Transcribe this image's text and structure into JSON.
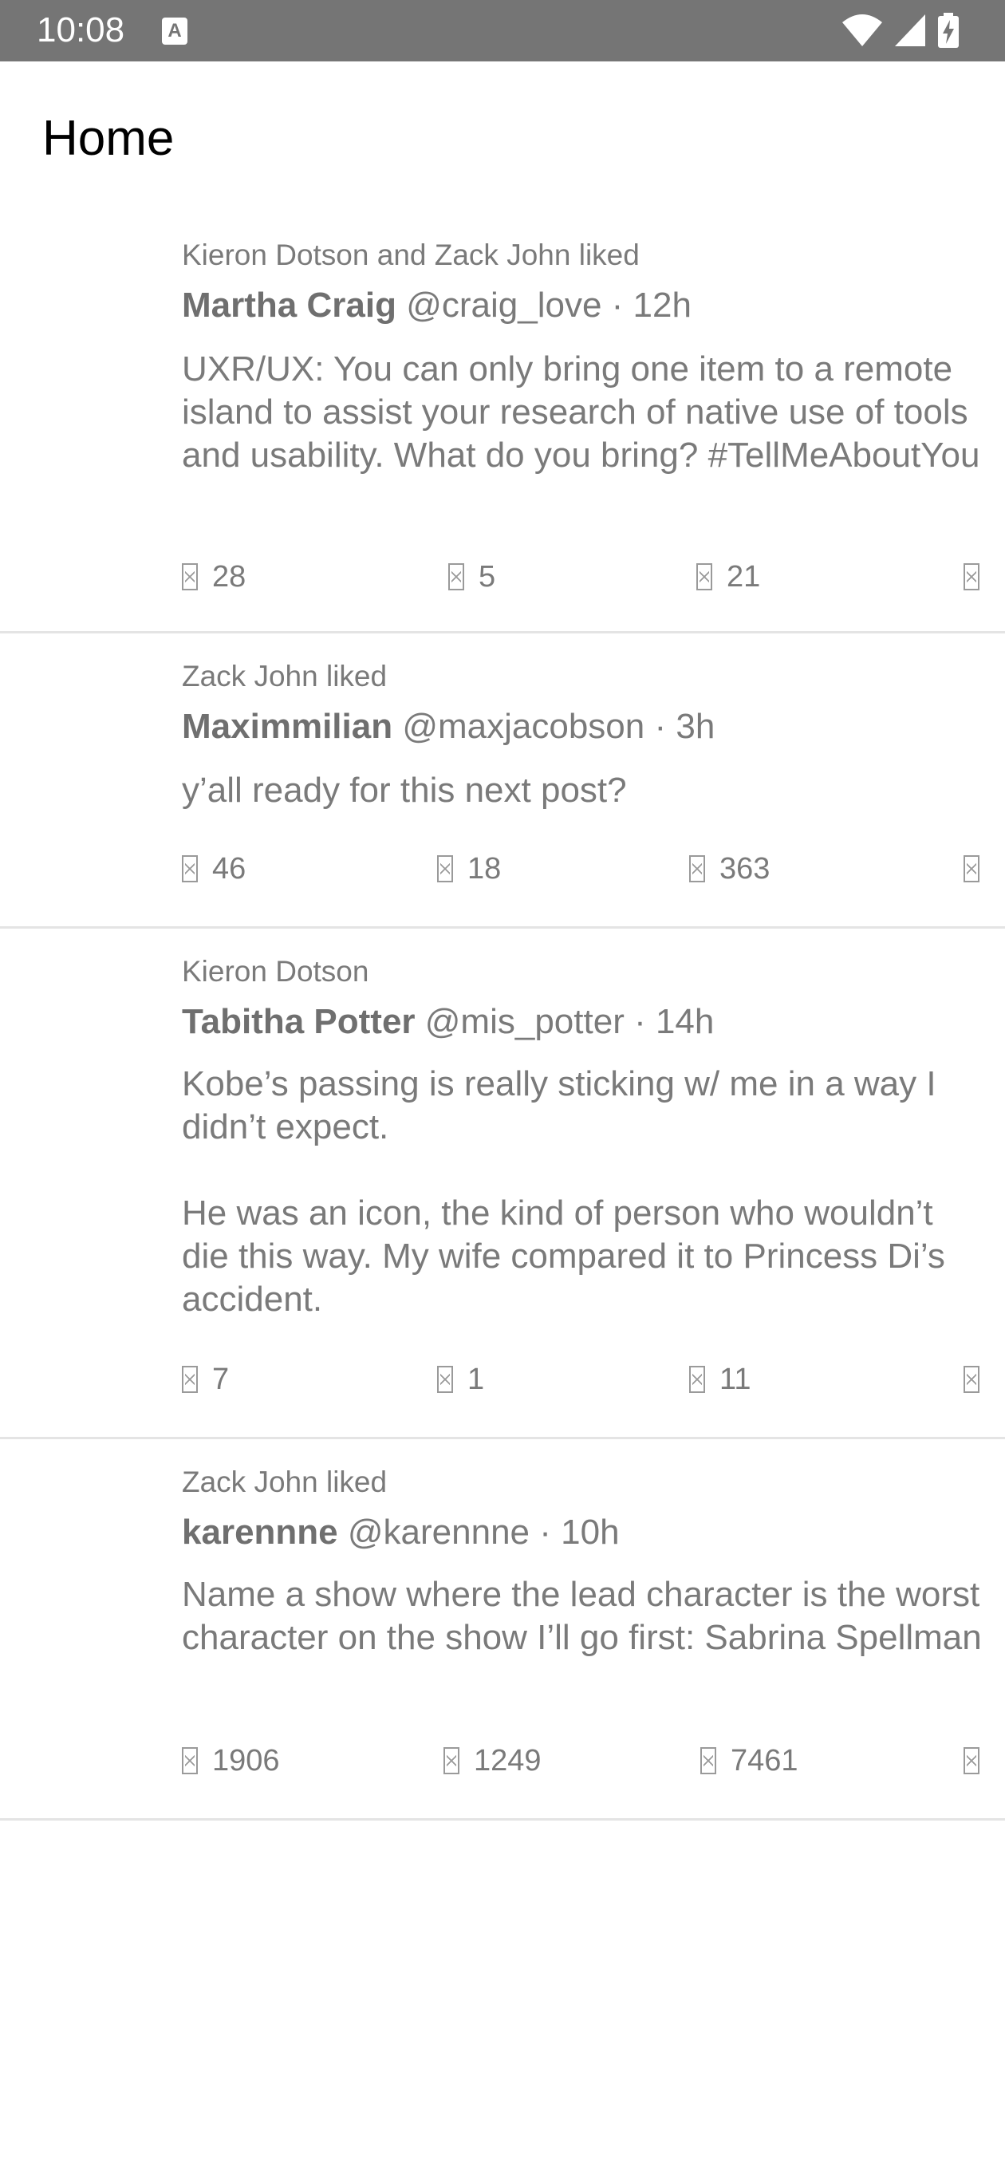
{
  "status_bar": {
    "time": "10:08",
    "notification_icon": "a-box-icon",
    "wifi_icon": "wifi-icon",
    "signal_icon": "signal-icon",
    "battery_icon": "battery-charging-icon"
  },
  "app_bar": {
    "title": "Home"
  },
  "tweets": [
    {
      "context": "Kieron Dotson and Zack John liked",
      "author": "Martha Craig",
      "handle": "@craig_love",
      "time": "· 12h",
      "body": "UXR/UX: You can only bring one item to a remote island to assist your research of native use of tools and usability. What do you bring? #TellMeAboutYou",
      "replies": "28",
      "retweets": "5",
      "likes": "21"
    },
    {
      "context": "Zack John liked",
      "author": "Maximmilian",
      "handle": "@maxjacobson",
      "time": "· 3h",
      "body": "y’all ready for this next post?",
      "replies": "46",
      "retweets": "18",
      "likes": "363"
    },
    {
      "context": "Kieron Dotson",
      "author": "Tabitha Potter",
      "handle": "@mis_potter",
      "time": "· 14h",
      "body": "Kobe’s passing is really sticking w/ me in a way I didn’t expect.\n\nHe was an icon, the kind of person who wouldn’t die this way. My wife compared it to Princess Di’s accident.",
      "replies": "7",
      "retweets": "1",
      "likes": "11"
    },
    {
      "context": "Zack John liked",
      "author": "karennne",
      "handle": "@karennne",
      "time": "· 10h",
      "body": "Name a show where the lead character is the worst character on the show I’ll go first: Sabrina Spellman",
      "replies": "1906",
      "retweets": "1249",
      "likes": "7461"
    }
  ],
  "colors": {
    "status_bar_bg": "#757575",
    "text_gray": "#7a7a7a",
    "divider": "#e4e4e4"
  }
}
